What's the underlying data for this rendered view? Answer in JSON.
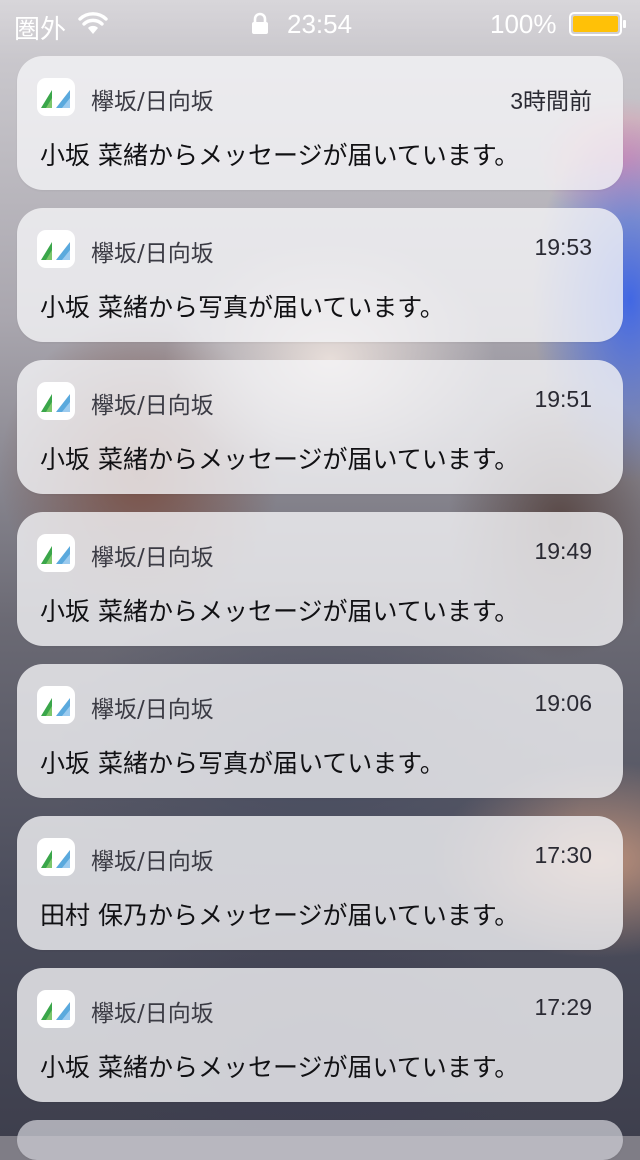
{
  "status_bar": {
    "carrier": "圏外",
    "wifi_icon": "wifi-icon",
    "lock_icon": "lock-icon",
    "time": "23:54",
    "battery_percent": "100%",
    "battery_icon": "battery-icon",
    "battery_level": 1.0,
    "battery_color": "#ffc107"
  },
  "notifications": [
    {
      "app": "欅坂/日向坂",
      "time": "3時間前",
      "message": "小坂 菜緒からメッセージが届いています。"
    },
    {
      "app": "欅坂/日向坂",
      "time": "19:53",
      "message": "小坂 菜緒から写真が届いています。"
    },
    {
      "app": "欅坂/日向坂",
      "time": "19:51",
      "message": "小坂 菜緒からメッセージが届いています。"
    },
    {
      "app": "欅坂/日向坂",
      "time": "19:49",
      "message": "小坂 菜緒からメッセージが届いています。"
    },
    {
      "app": "欅坂/日向坂",
      "time": "19:06",
      "message": "小坂 菜緒から写真が届いています。"
    },
    {
      "app": "欅坂/日向坂",
      "time": "17:30",
      "message": "田村 保乃からメッセージが届いています。"
    },
    {
      "app": "欅坂/日向坂",
      "time": "17:29",
      "message": "小坂 菜緒からメッセージが届いています。"
    }
  ],
  "app_icon": "app-logo-icon",
  "colors": {
    "icon_green": "#3aa64a",
    "icon_blue": "#5aa9dd",
    "card_background": "#f4f4f6"
  }
}
